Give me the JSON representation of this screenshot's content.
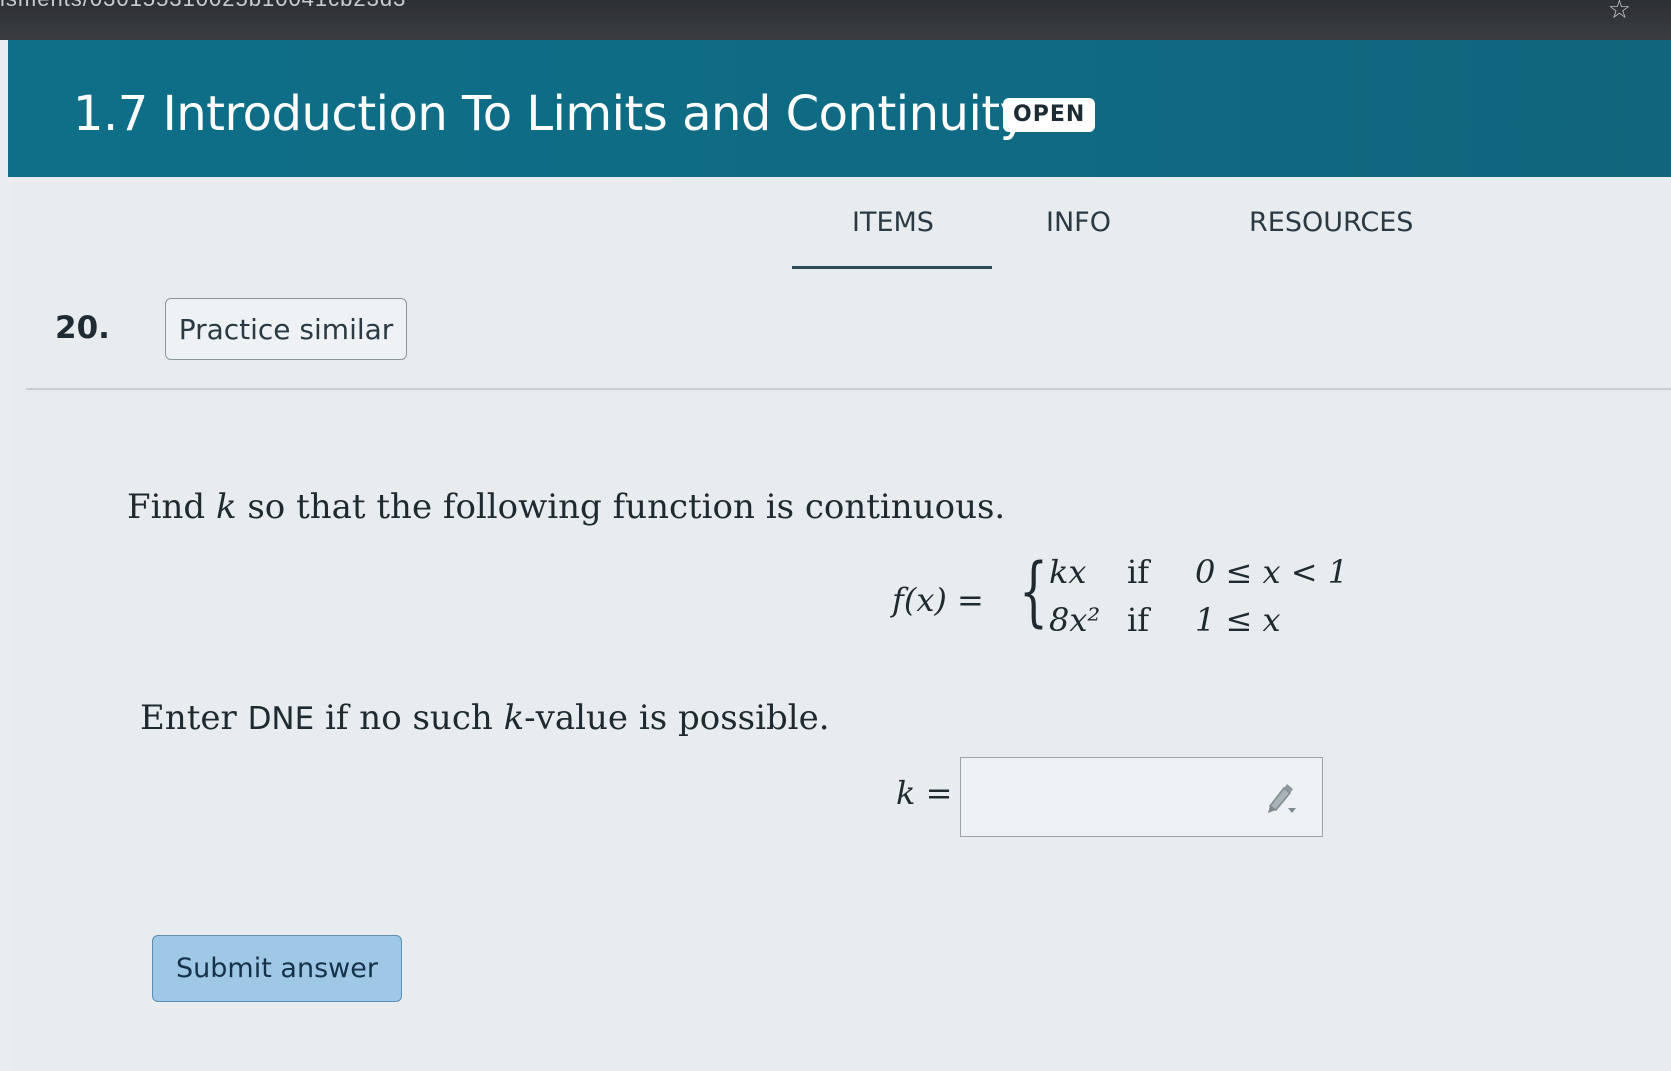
{
  "browser": {
    "url_fragment": "isments/030155310025b10041cb23d3"
  },
  "header": {
    "title": "1.7 Introduction To Limits and Continuity",
    "status_badge": "OPEN"
  },
  "tabs": [
    {
      "label": "ITEMS",
      "active": true
    },
    {
      "label": "INFO",
      "active": false
    },
    {
      "label": "RESOURCES",
      "active": false
    }
  ],
  "question": {
    "number": "20.",
    "practice_button": "Practice similar",
    "prompt_before": "Find ",
    "prompt_var": "k",
    "prompt_after": " so that the following function is continuous.",
    "equation": {
      "lhs": "f(x) =",
      "cases": [
        {
          "expr": "kx",
          "if": "if",
          "cond": "0 ≤ x < 1"
        },
        {
          "expr": "8x²",
          "if": "if",
          "cond": "1 ≤ x"
        }
      ]
    },
    "instruction_before": "Enter ",
    "instruction_dne": "DNE",
    "instruction_middle": " if no such ",
    "instruction_var": "k",
    "instruction_after": "-value is possible.",
    "answer_label": "k =",
    "answer_value": "",
    "submit_label": "Submit answer"
  },
  "colors": {
    "header": "#0f6f88",
    "submit_button": "#9fc8e6",
    "background": "#e8ecee"
  }
}
